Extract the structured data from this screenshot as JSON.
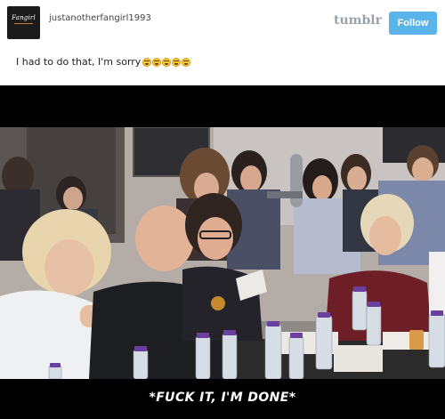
{
  "post": {
    "avatar_text": "Fangirl",
    "username": "justanotherfangirl1993",
    "brand": "tumblr",
    "follow_label": "Follow",
    "caption": "I had to do that, I'm sorry",
    "emoji_icons": [
      "grinning-sweat-icon",
      "grinning-sweat-icon",
      "grinning-sweat-icon",
      "grinning-sweat-icon",
      "grinning-sweat-icon"
    ]
  },
  "video": {
    "subtitle": "*FUCK IT, I'M DONE*"
  },
  "colors": {
    "follow_button": "#5bb4e9",
    "brand_text": "#9aa3ab",
    "video_background": "#000000"
  }
}
